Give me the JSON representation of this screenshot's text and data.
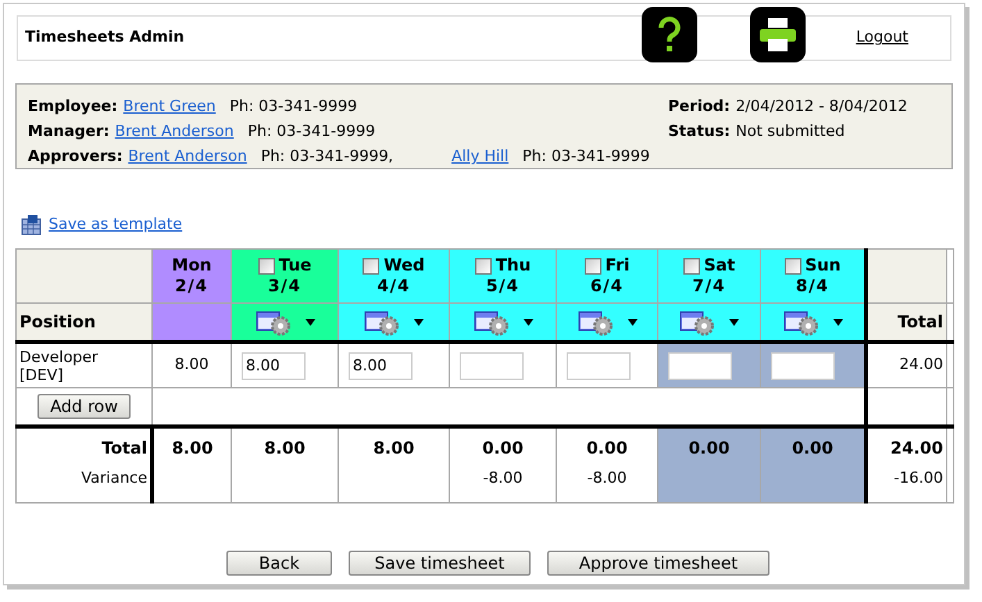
{
  "header": {
    "title": "Timesheets Admin",
    "logout": "Logout"
  },
  "info": {
    "employee": {
      "label": "Employee:",
      "name": "Brent Green",
      "phone": "Ph: 03-341-9999"
    },
    "manager": {
      "label": "Manager:",
      "name": "Brent Anderson",
      "phone": "Ph: 03-341-9999"
    },
    "approvers_label": "Approvers:",
    "approvers": [
      {
        "name": "Brent Anderson",
        "phone": "Ph: 03-341-9999,"
      },
      {
        "name": "Ally Hill",
        "phone": "Ph: 03-341-9999"
      }
    ],
    "period": {
      "label": "Period:",
      "value": "2/04/2012 - 8/04/2012"
    },
    "status": {
      "label": "Status:",
      "value": "Not submitted"
    }
  },
  "save_template": "Save as template",
  "table": {
    "position_header": "Position",
    "total_header": "Total",
    "days": [
      {
        "kind": "locked",
        "day": "Mon",
        "date": "2/4",
        "color": "#b08cff",
        "shaded": false,
        "hours": "8.00",
        "total": "8.00"
      },
      {
        "kind": "editable",
        "day": "Tue",
        "date": "3/4",
        "color": "#19ff9a",
        "checked": false,
        "shaded": false,
        "hours": "8.00",
        "total": "8.00"
      },
      {
        "kind": "editable",
        "day": "Wed",
        "date": "4/4",
        "color": "#33ffff",
        "checked": false,
        "shaded": false,
        "hours": "8.00",
        "total": "8.00"
      },
      {
        "kind": "editable",
        "day": "Thu",
        "date": "5/4",
        "color": "#33ffff",
        "checked": false,
        "shaded": false,
        "total": "0.00",
        "variance": "-8.00"
      },
      {
        "kind": "editable",
        "day": "Fri",
        "date": "6/4",
        "color": "#33ffff",
        "checked": false,
        "shaded": false,
        "total": "0.00",
        "variance": "-8.00"
      },
      {
        "kind": "editable",
        "day": "Sat",
        "date": "7/4",
        "color": "#33ffff",
        "checked": false,
        "shaded": true,
        "total": "0.00"
      },
      {
        "kind": "editable",
        "day": "Sun",
        "date": "8/4",
        "color": "#33ffff",
        "checked": false,
        "shaded": true,
        "total": "0.00"
      }
    ],
    "row": {
      "position": "Developer [DEV]",
      "total": "24.00"
    },
    "add_row": "Add row",
    "total_label": "Total",
    "grand_total": "24.00",
    "variance_label": "Variance",
    "total_variance": "-16.00"
  },
  "buttons": [
    "Back",
    "Save timesheet",
    "Approve timesheet"
  ]
}
